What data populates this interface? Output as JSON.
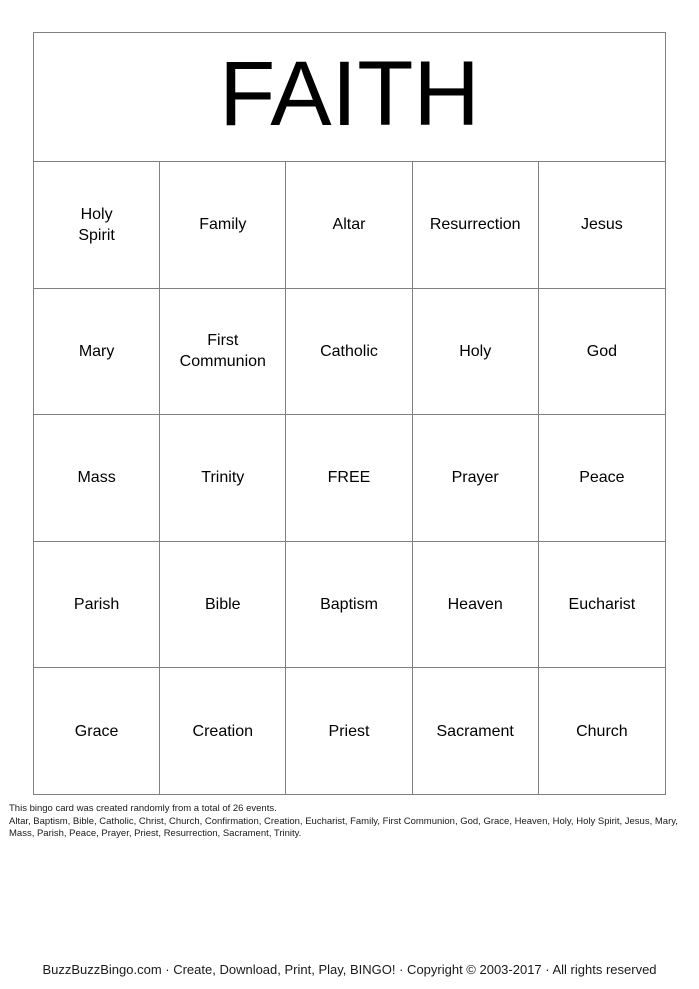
{
  "card": {
    "title": "FAITH",
    "free_space_label": "FREE",
    "columns": 5,
    "rows": 5,
    "border_color": "#808080",
    "background_color": "#ffffff",
    "text_color": "#000000",
    "cells": [
      [
        "Holy\nSpirit",
        "Family",
        "Altar",
        "Resurrection",
        "Jesus"
      ],
      [
        "Mary",
        "First\nCommunion",
        "Catholic",
        "Holy",
        "God"
      ],
      [
        "Mass",
        "Trinity",
        "FREE",
        "Prayer",
        "Peace"
      ],
      [
        "Parish",
        "Bible",
        "Baptism",
        "Heaven",
        "Eucharist"
      ],
      [
        "Grace",
        "Creation",
        "Priest",
        "Sacrament",
        "Church"
      ]
    ]
  },
  "note": {
    "line1": "This bingo card was created randomly from a total of 26 events.",
    "line2": "Altar, Baptism, Bible, Catholic, Christ, Church, Confirmation, Creation, Eucharist, Family, First Communion, God, Grace, Heaven, Holy, Holy Spirit, Jesus, Mary,",
    "line3": "Mass, Parish, Peace, Prayer, Priest, Resurrection, Sacrament, Trinity.",
    "total_events": 26
  },
  "footer": {
    "text": "BuzzBuzzBingo.com · Create, Download, Print, Play, BINGO! · Copyright © 2003-2017 · All rights reserved",
    "site": "BuzzBuzzBingo.com",
    "tagline": "Create, Download, Print, Play, BINGO!",
    "copyright": "Copyright © 2003-2017",
    "rights": "All rights reserved"
  }
}
